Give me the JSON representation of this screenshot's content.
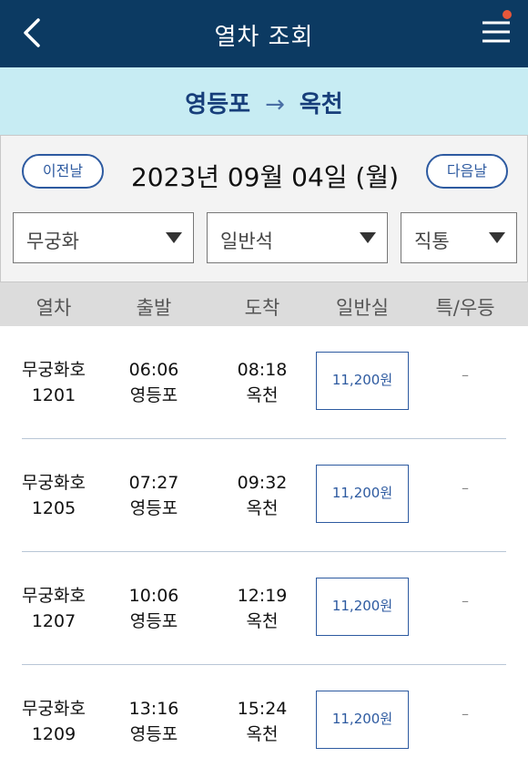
{
  "header": {
    "title": "열차 조회",
    "back_icon": "chevron-left-icon",
    "menu_icon": "hamburger-menu-icon"
  },
  "route": {
    "from": "영등포",
    "arrow": "→",
    "to": "옥천"
  },
  "date_bar": {
    "prev_label": "이전날",
    "date": "2023년 09월 04일 (월)",
    "next_label": "다음날"
  },
  "filters": {
    "train_type": "무궁화",
    "seat_type": "일반석",
    "route_type": "직통"
  },
  "columns": [
    "열차",
    "출발",
    "도착",
    "일반실",
    "특/우등"
  ],
  "trains": [
    {
      "name": "무궁화호",
      "number": "1201",
      "dep_time": "06:06",
      "dep_station": "영등포",
      "arr_time": "08:18",
      "arr_station": "옥천",
      "fare": "11,200원",
      "special": "–"
    },
    {
      "name": "무궁화호",
      "number": "1205",
      "dep_time": "07:27",
      "dep_station": "영등포",
      "arr_time": "09:32",
      "arr_station": "옥천",
      "fare": "11,200원",
      "special": "–"
    },
    {
      "name": "무궁화호",
      "number": "1207",
      "dep_time": "10:06",
      "dep_station": "영등포",
      "arr_time": "12:19",
      "arr_station": "옥천",
      "fare": "11,200원",
      "special": "–"
    },
    {
      "name": "무궁화호",
      "number": "1209",
      "dep_time": "13:16",
      "dep_station": "영등포",
      "arr_time": "15:24",
      "arr_station": "옥천",
      "fare": "11,200원",
      "special": "–"
    }
  ],
  "colors": {
    "header_bg": "#0c3a62",
    "route_bg": "#c7ecf3",
    "accent": "#2d5aa0",
    "notification_dot": "#e8573a"
  }
}
